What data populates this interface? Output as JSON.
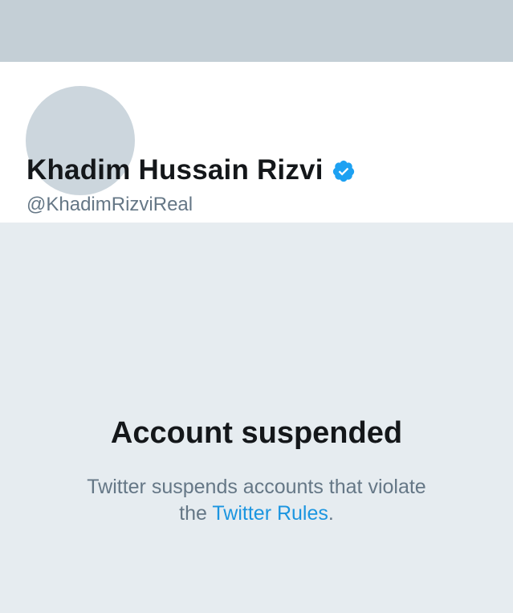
{
  "profile": {
    "display_name": "Khadim Hussain Rizvi",
    "handle": "@KhadimRizviReal",
    "verified_icon": "verified-badge-icon"
  },
  "suspension": {
    "title": "Account suspended",
    "desc_line1": "Twitter suspends accounts that violate",
    "desc_prefix": "the ",
    "rules_link": "Twitter Rules",
    "desc_suffix": "."
  },
  "colors": {
    "banner": "#c4cfd6",
    "avatar": "#ccd6dd",
    "background": "#e6ecf0",
    "verified": "#1da1f2",
    "link": "#1b95e0",
    "secondary_text": "#657786",
    "primary_text": "#14171a"
  }
}
